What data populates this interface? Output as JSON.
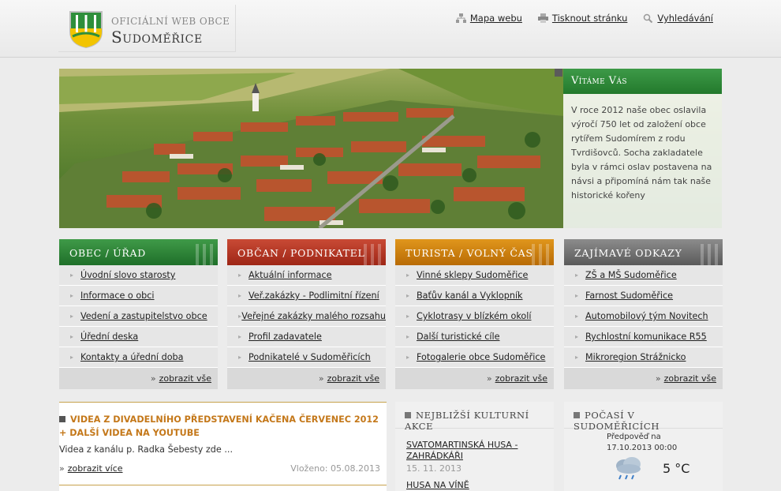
{
  "header": {
    "subtitle": "OFICIÁLNÍ WEB OBCE",
    "title": "Sudoměřice",
    "links": [
      {
        "label": "Mapa webu",
        "icon": "sitemap-icon"
      },
      {
        "label": "Tisknout stránku",
        "icon": "printer-icon"
      },
      {
        "label": "Vyhledávání",
        "icon": "search-icon"
      }
    ]
  },
  "welcome": {
    "title": "Vítáme Vás",
    "text": "V roce 2012 naše obec oslavila výročí 750 let od založení obce rytířem Sudomírem z rodu Tvrdišovců. Socha zakladatele byla v rámci oslav postavena na návsi a připomíná nám tak naše historické kořeny"
  },
  "columns": [
    {
      "title": "OBEC / ÚŘAD",
      "color": "#2c8a36",
      "items": [
        "Úvodní slovo starosty",
        "Informace o obci",
        "Vedení a zastupitelstvo obce",
        "Úřední deska",
        "Kontakty a úřední doba"
      ],
      "more": "zobrazit vše"
    },
    {
      "title": "OBČAN / PODNIKATEL",
      "color": "#b8351f",
      "items": [
        "Aktuální informace",
        "Veř.zakázky - Podlimitní řízení",
        "Veřejné zakázky malého rozsahu",
        "Profil zadavatele",
        "Podnikatelé v Sudoměřicích"
      ],
      "more": "zobrazit vše"
    },
    {
      "title": "TURISTA / VOLNÝ ČAS",
      "color": "#cf8410",
      "items": [
        "Vinné sklepy Sudoměřice",
        "Baťův kanál a Vyklopník",
        "Cyklotrasy v blízkém okolí",
        "Další turistické cíle",
        "Fotogalerie obce Sudoměřice"
      ],
      "more": "zobrazit vše"
    },
    {
      "title": "ZAJÍMAVÉ ODKAZY",
      "color": "#707070",
      "items": [
        "ZŠ a MŠ Sudoměřice",
        "Farnost Sudoměřice",
        "Automobilový tým Novitech",
        "Rychlostní komunikace R55",
        "Mikroregion Strážnicko"
      ],
      "more": "zobrazit vše"
    }
  ],
  "news": {
    "title": "VIDEA Z DIVADELNÍHO PŘEDSTAVENÍ KAČENA ČERVENEC 2012 + DALŠÍ VIDEA NA YOUTUBE",
    "text": "Videa z kanálu p. Radka Šebesty zde ...",
    "more": "zobrazit více",
    "date": "Vloženo: 05.08.2013"
  },
  "events": {
    "title": "NEJBLIŽŠÍ KULTURNÍ AKCE",
    "items": [
      {
        "name": "SVATOMARTINSKÁ HUSA - ZAHRÁDKÁŘI",
        "date": "15. 11. 2013"
      },
      {
        "name": "HUSA NA VÍNĚ",
        "date": ""
      }
    ]
  },
  "weather": {
    "title": "POČASÍ V SUDOMĚŘICÍCH",
    "forecast_label": "Předpověď na",
    "forecast_time": "17.10.2013 00:00",
    "temperature": "5 °C",
    "icon": "cloud-rain-icon"
  }
}
